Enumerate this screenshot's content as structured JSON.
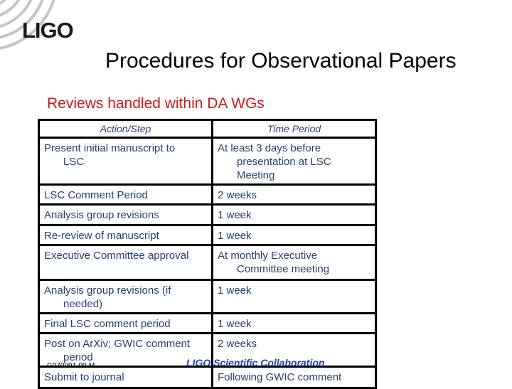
{
  "logo": {
    "text": "LIGO",
    "icon": "ligo-arcs-icon"
  },
  "slide": {
    "title": "Procedures for Observational Papers",
    "subtitle": "Reviews handled within DA WGs"
  },
  "table": {
    "headers": [
      "Action/Step",
      "Time Period"
    ],
    "rows": [
      {
        "action": [
          "Present initial manuscript to",
          "LSC"
        ],
        "period": [
          "At least 3 days before",
          "presentation at LSC Meeting"
        ]
      },
      {
        "action": [
          "LSC Comment Period",
          ""
        ],
        "period": [
          "2 weeks",
          ""
        ]
      },
      {
        "action": [
          "Analysis group revisions",
          ""
        ],
        "period": [
          "1 week",
          ""
        ]
      },
      {
        "action": [
          "Re-review of manuscript",
          ""
        ],
        "period": [
          "1 week",
          ""
        ]
      },
      {
        "action": [
          "Executive Committee approval",
          ""
        ],
        "period": [
          "At monthly Executive",
          "Committee meeting"
        ]
      },
      {
        "action": [
          "Analysis group revisions (if",
          "needed)"
        ],
        "period": [
          "1 week",
          ""
        ]
      },
      {
        "action": [
          "Final LSC comment period",
          ""
        ],
        "period": [
          "1 week",
          ""
        ]
      },
      {
        "action": [
          "Post on ArXiv; GWIC comment",
          "period"
        ],
        "period": [
          "2 weeks",
          ""
        ]
      },
      {
        "action": [
          "Submit to journal",
          ""
        ],
        "period": [
          "Following GWIC comment",
          ""
        ]
      }
    ]
  },
  "footer": {
    "doc_id": "G070091-00-M",
    "collaboration": "LIGO Scientific Collaboration"
  }
}
